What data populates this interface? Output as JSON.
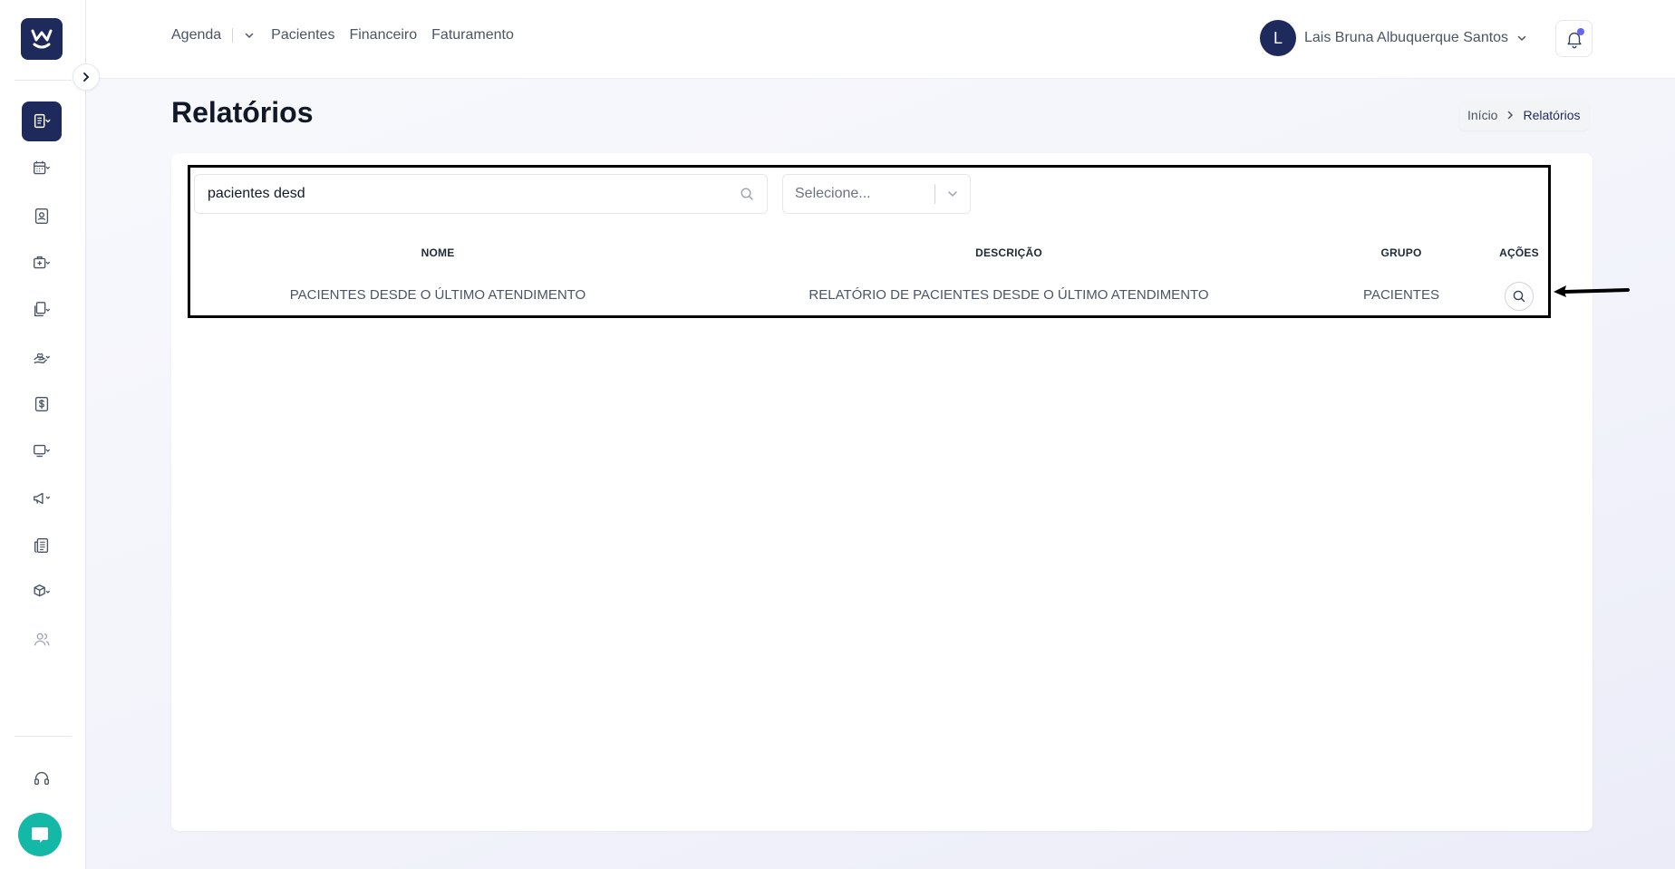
{
  "header": {
    "nav": [
      {
        "label": "Agenda"
      },
      {
        "label": "Pacientes"
      },
      {
        "label": "Financeiro"
      },
      {
        "label": "Faturamento"
      }
    ],
    "user": {
      "initial": "L",
      "name": "Lais Bruna Albuquerque Santos"
    }
  },
  "page": {
    "title": "Relatórios",
    "breadcrumb": {
      "home": "Início",
      "current": "Relatórios"
    }
  },
  "filters": {
    "search_value": "pacientes desd",
    "select_placeholder": "Selecione..."
  },
  "table": {
    "columns": [
      "NOME",
      "DESCRIÇÃO",
      "GRUPO",
      "AÇÕES"
    ],
    "rows": [
      {
        "nome": "PACIENTES DESDE O ÚLTIMO ATENDIMENTO",
        "descricao": "RELATÓRIO DE PACIENTES DESDE O ÚLTIMO ATENDIMENTO",
        "grupo": "PACIENTES"
      }
    ]
  },
  "colors": {
    "brand": "#1e2a5c",
    "chat": "#14b8a6",
    "notification_dot": "#6366f1"
  }
}
